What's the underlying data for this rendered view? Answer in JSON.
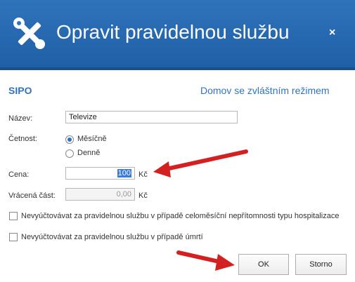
{
  "window": {
    "title": "Opravit pravidelnou službu",
    "close_label": "×"
  },
  "header": {
    "service_code": "SIPO",
    "mode_link": "Domov se zvláštním režimem"
  },
  "form": {
    "name_label": "Název:",
    "name_value": "Televize",
    "frequency_label": "Četnost:",
    "frequency_options": [
      "Měsíčně",
      "Denně"
    ],
    "frequency_selected": "Měsíčně",
    "price_label": "Cena:",
    "price_value": "100",
    "price_unit": "Kč",
    "refund_label": "Vrácená část:",
    "refund_value": "0,00",
    "refund_unit": "Kč",
    "checkbox_hospital": "Nevyúčtovávat za pravidelnou službu v případě celoměsíční nepřítomnosti typu hospitalizace",
    "checkbox_death": "Nevyúčtovávat za pravidelnou službu v případě úmrtí"
  },
  "buttons": {
    "ok_label": "OK",
    "cancel_label": "Storno"
  },
  "colors": {
    "titlebar": "#2f74bb",
    "accent": "#2f74bb",
    "annotation_arrow": "#d42020"
  },
  "icons": {
    "title_icon": "wrench-screwdriver-icon"
  }
}
